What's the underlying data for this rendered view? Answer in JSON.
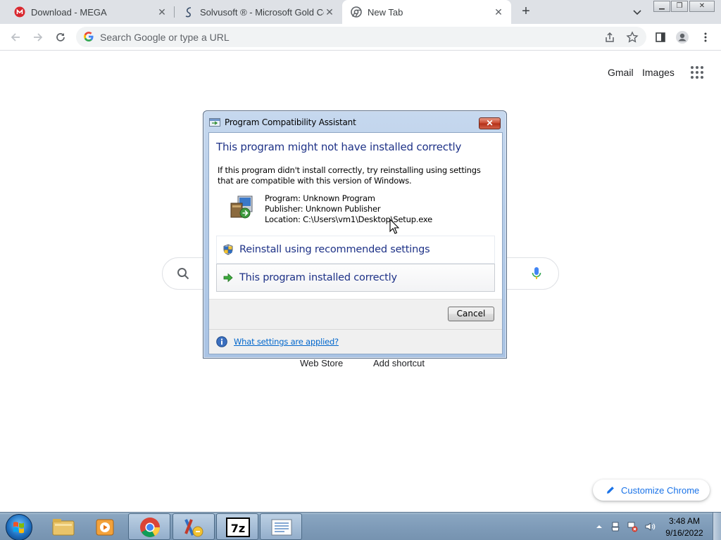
{
  "browser": {
    "tabs": [
      {
        "title": "Download - MEGA",
        "icon": "mega-icon"
      },
      {
        "title": "Solvusoft ® - Microsoft Gold Certified",
        "icon": "solvusoft-icon"
      },
      {
        "title": "New Tab",
        "icon": "chrome-icon",
        "active": true
      }
    ],
    "omnibox_placeholder": "Search Google or type a URL"
  },
  "ntp": {
    "gmail": "Gmail",
    "images": "Images",
    "shortcuts": [
      "Web Store",
      "Add shortcut"
    ],
    "customize": "Customize Chrome"
  },
  "dialog": {
    "title": "Program Compatibility Assistant",
    "heading": "This program might not have installed correctly",
    "description": "If this program didn't install correctly, try reinstalling using settings that are compatible with this version of Windows.",
    "program": "Program: Unknown Program",
    "publisher": "Publisher: Unknown Publisher",
    "location": "Location: C:\\Users\\vm1\\Desktop\\Setup.exe",
    "option_reinstall": "Reinstall using recommended settings",
    "option_correct": "This program installed correctly",
    "cancel": "Cancel",
    "help_link": "What settings are applied?"
  },
  "taskbar": {
    "time": "3:48 AM",
    "date": "9/16/2022",
    "pinned": [
      "windows-explorer-icon",
      "media-player-icon",
      "chrome-icon",
      "setup-installer-icon",
      "7zip-icon",
      "notepad-icon"
    ]
  },
  "colors": {
    "accent": "#1a73e8",
    "dialog_heading": "#1e3287",
    "link": "#0066cc"
  }
}
